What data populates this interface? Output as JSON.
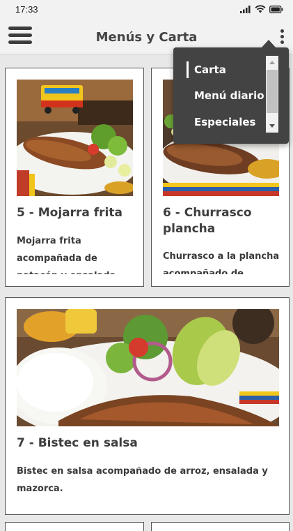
{
  "status": {
    "time": "17:33"
  },
  "appbar": {
    "title": "Menús y Carta"
  },
  "cards": [
    {
      "title": "5 - Mojarra frita",
      "description": "Mojarra frita acompañada de patacón y ensalada"
    },
    {
      "title": "6 - Churrasco plancha",
      "description": "Churrasco a la plancha acompañado de"
    },
    {
      "title": "7 - Bistec en salsa",
      "description": "Bistec en salsa acompañado de arroz, ensalada y mazorca."
    }
  ],
  "popup_menu": {
    "items": [
      {
        "label": "Carta",
        "active": true
      },
      {
        "label": "Menú diario",
        "active": false
      },
      {
        "label": "Especiales",
        "active": false
      }
    ]
  }
}
